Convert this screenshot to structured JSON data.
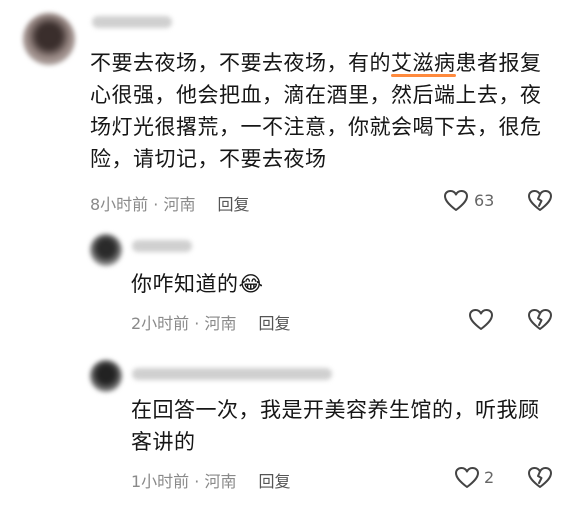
{
  "comments": [
    {
      "lines": [
        "不要去夜场，不要去夜场，有的",
        "艾滋病",
        "患者报复"
      ],
      "line2": "心很强，他会把血，滴在酒里，然后端上去，夜",
      "line3": "场灯光很撂荒，一不注意，你就会喝下去，很危",
      "line4": "险，请切记，不要去夜场",
      "time": "8小时前 · 河南",
      "reply": "回复",
      "likes": "63"
    },
    {
      "text": "你咋知道的",
      "emoji": "😂",
      "time": "2小时前 · 河南",
      "reply": "回复"
    },
    {
      "line1": "在回答一次，我是开美容养生馆的，听我顾",
      "line2": "客讲的",
      "time": "1小时前 · 河南",
      "reply": "回复",
      "likes": "2"
    }
  ],
  "icons": [
    "heart-icon",
    "broken-heart-icon"
  ]
}
